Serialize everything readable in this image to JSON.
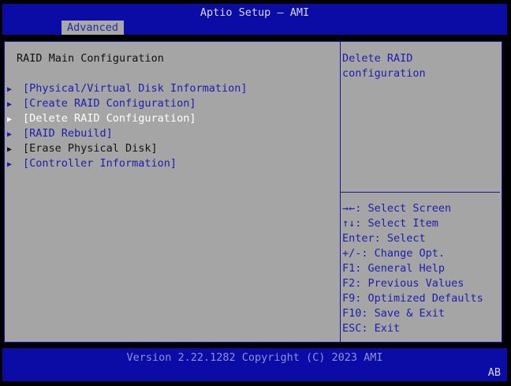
{
  "header": {
    "title": "Aptio Setup – AMI",
    "tabs": [
      {
        "label": "Advanced",
        "active": true
      }
    ]
  },
  "main": {
    "section_title": "RAID Main Configuration",
    "menu": [
      {
        "label": "[Physical/Virtual Disk Information]",
        "state": "normal"
      },
      {
        "label": "[Create RAID Configuration]",
        "state": "normal"
      },
      {
        "label": "[Delete RAID Configuration]",
        "state": "selected"
      },
      {
        "label": "[RAID Rebuild]",
        "state": "normal"
      },
      {
        "label": "[Erase Physical Disk]",
        "state": "disabled"
      },
      {
        "label": "[Controller Information]",
        "state": "normal"
      }
    ],
    "arrow_icon": "▶"
  },
  "help": {
    "line1": "Delete RAID",
    "line2": "configuration"
  },
  "keys": [
    "→←: Select Screen",
    "↑↓: Select Item",
    "Enter: Select",
    "+/-: Change Opt.",
    "F1: General Help",
    "F2: Previous Values",
    "F9: Optimized Defaults",
    "F10: Save & Exit",
    "ESC: Exit"
  ],
  "footer": {
    "version": "Version 2.22.1282 Copyright (C) 2023 AMI",
    "corner": "AB"
  },
  "colors": {
    "header_bg": "#0b0ba6",
    "panel_bg": "#a5a5a5",
    "text_blue": "#1d1db0",
    "selected_text": "#ffffff"
  }
}
